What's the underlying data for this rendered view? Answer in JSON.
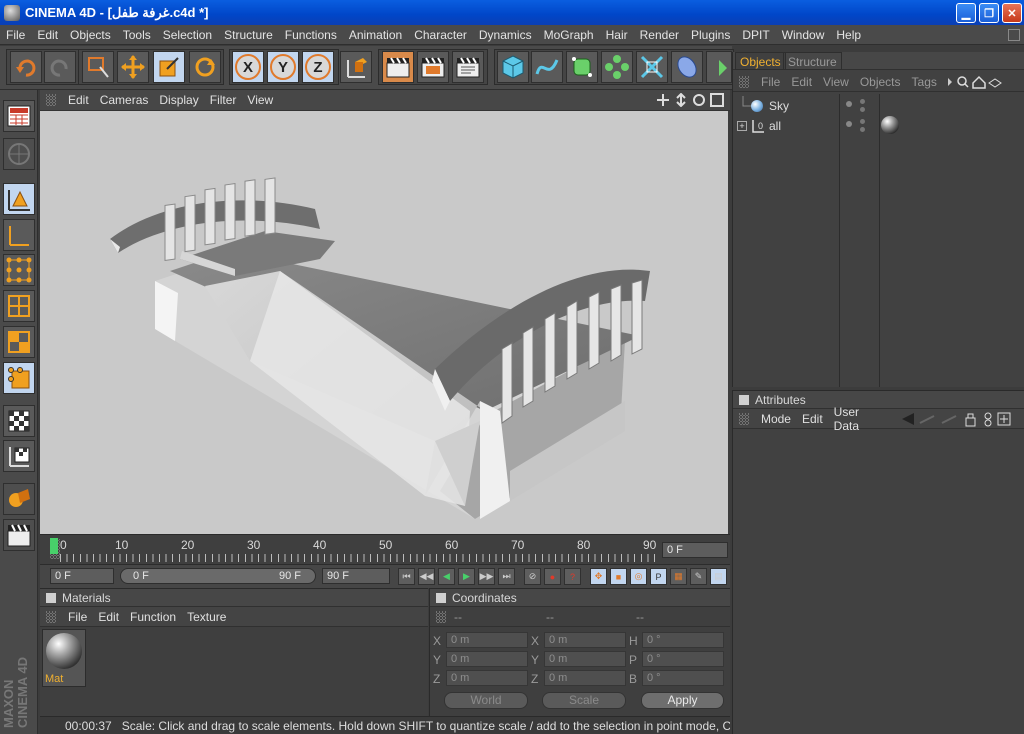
{
  "window": {
    "title": "CINEMA 4D - [غرفة طفل.c4d *]",
    "minimize_glyph": "▁",
    "restore_glyph": "❐",
    "close_glyph": "✕"
  },
  "menu": [
    "File",
    "Edit",
    "Objects",
    "Tools",
    "Selection",
    "Structure",
    "Functions",
    "Animation",
    "Character",
    "Dynamics",
    "MoGraph",
    "Hair",
    "Render",
    "Plugins",
    "DPIT",
    "Window",
    "Help"
  ],
  "toolbar": {
    "icons": [
      "undo-icon",
      "redo-icon",
      "live-selection-icon",
      "move-icon",
      "scale-icon",
      "rotate-icon",
      "x-axis-icon",
      "y-axis-icon",
      "z-axis-icon",
      "world-coordinates-icon",
      "render-view-icon",
      "render-picture-viewer-icon",
      "render-settings-icon",
      "cube-icon",
      "spline-pen-icon",
      "nurbs-icon",
      "array-icon",
      "deformer-icon",
      "environment-icon",
      "camera-icon"
    ],
    "axis_labels": [
      "X",
      "Y",
      "Z"
    ]
  },
  "left_toolbar": {
    "icons": [
      "use-model-mode-icon",
      "use-object-tool-icon",
      "use-model-tool-icon",
      "use-object-axis-icon",
      "use-point-tool-icon",
      "use-edge-tool-icon",
      "use-polygon-tool-icon",
      "use-texture-tool-icon",
      "use-texture-axis-icon",
      "use-animation-tool-icon",
      "enable-axis-icon",
      "render-region-icon"
    ],
    "brand_line1": "MAXON",
    "brand_line2": "CINEMA 4D"
  },
  "viewport": {
    "menu": [
      "Edit",
      "Cameras",
      "Display",
      "Filter",
      "View"
    ],
    "background": "#c9c9c9"
  },
  "timeline": {
    "ticks": [
      "0",
      "10",
      "20",
      "30",
      "40",
      "50",
      "60",
      "70",
      "80",
      "90"
    ],
    "current_frame": "0 F"
  },
  "transport": {
    "start_field": "0 F",
    "range_start": "0 F",
    "range_end": "90 F",
    "end_field": "90 F"
  },
  "materials": {
    "title": "Materials",
    "menu": [
      "File",
      "Edit",
      "Function",
      "Texture"
    ],
    "items": [
      {
        "name": "Mat"
      }
    ]
  },
  "coordinates": {
    "title": "Coordinates",
    "headers": [
      "--",
      "--",
      "--"
    ],
    "rows": [
      {
        "l1": "X",
        "v1": "0 m",
        "l2": "X",
        "v2": "0 m",
        "l3": "H",
        "v3": "0 °"
      },
      {
        "l1": "Y",
        "v1": "0 m",
        "l2": "Y",
        "v2": "0 m",
        "l3": "P",
        "v3": "0 °"
      },
      {
        "l1": "Z",
        "v1": "0 m",
        "l2": "Z",
        "v2": "0 m",
        "l3": "B",
        "v3": "0 °"
      }
    ],
    "mode_dropdown": "World",
    "size_dropdown": "Scale",
    "apply_label": "Apply"
  },
  "status": {
    "time": "00:00:37",
    "message": "Scale: Click and drag to scale elements. Hold down SHIFT to quantize scale / add to the selection in point mode, CTRL to remove"
  },
  "objects_manager": {
    "tabs": [
      "Objects",
      "Structure"
    ],
    "menu": [
      "File",
      "Edit",
      "View",
      "Objects",
      "Tags"
    ],
    "items": [
      {
        "name": "Sky",
        "expander": ""
      },
      {
        "name": "all",
        "expander": "+"
      }
    ]
  },
  "attributes": {
    "title": "Attributes",
    "menu": [
      "Mode",
      "Edit",
      "User Data"
    ]
  },
  "colors": {
    "accent_active": "#c2d6ef",
    "tab_active": "#f0b030",
    "timeline_marker": "#48d06a"
  }
}
